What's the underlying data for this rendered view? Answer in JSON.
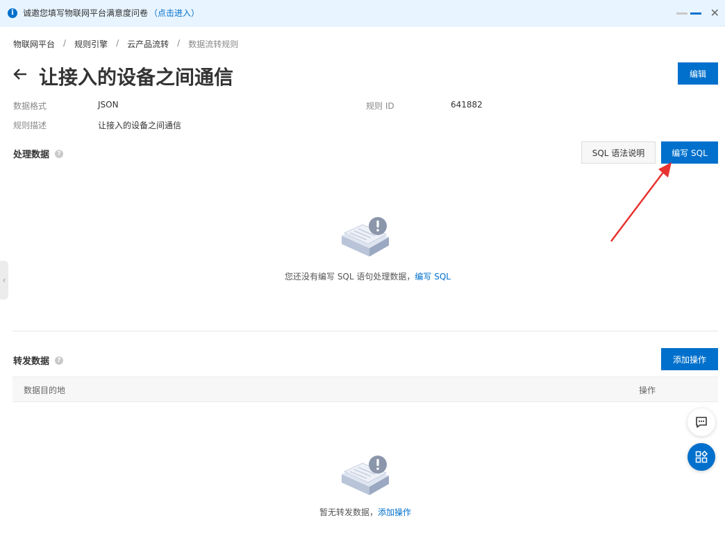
{
  "notice": {
    "message": "诚邀您填写物联网平台满意度问卷",
    "link": "（点击进入）"
  },
  "breadcrumb": [
    "物联网平台",
    "规则引擎",
    "云产品流转",
    "数据流转规则"
  ],
  "header": {
    "title": "让接入的设备之间通信",
    "edit_label": "编辑"
  },
  "meta": {
    "format_label": "数据格式",
    "format_value": "JSON",
    "rule_id_label": "规则 ID",
    "rule_id_value": "641882",
    "desc_label": "规则描述",
    "desc_value": "让接入的设备之间通信"
  },
  "process": {
    "title": "处理数据",
    "sql_help_label": "SQL 语法说明",
    "write_sql_label": "编写 SQL",
    "empty_text": "您还没有编写 SQL 语句处理数据，",
    "empty_link": "编写 SQL"
  },
  "forward": {
    "title": "转发数据",
    "add_label": "添加操作",
    "columns": [
      "数据目的地",
      "操作"
    ],
    "empty_text": "暂无转发数据，",
    "empty_link": "添加操作"
  },
  "colors": {
    "primary": "#0070cc",
    "annotation": "#e8322f"
  }
}
